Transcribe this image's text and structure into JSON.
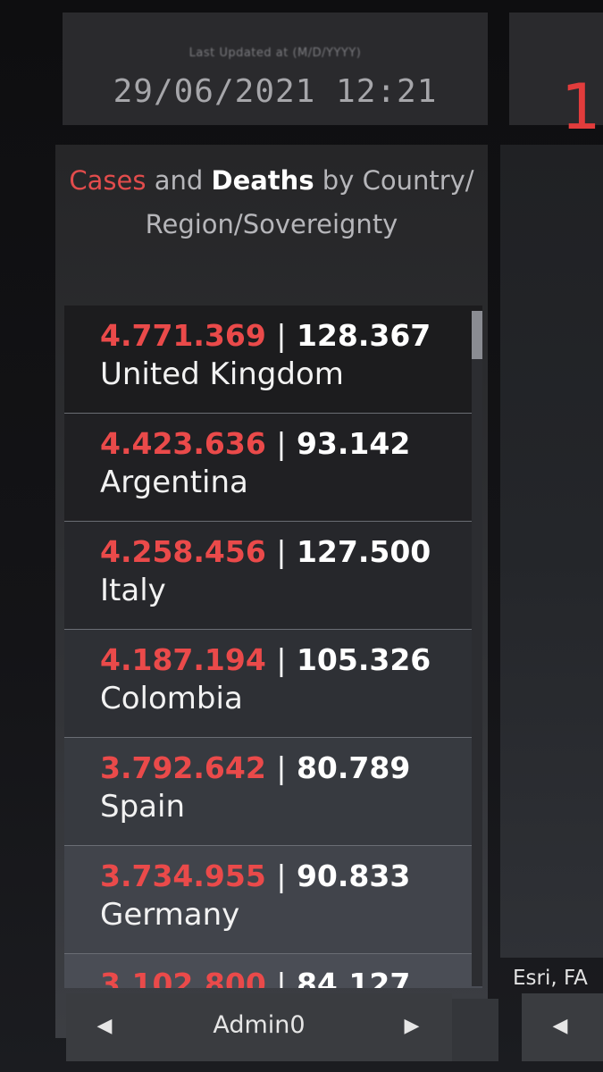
{
  "header": {
    "last_updated_label": "Last Updated at (M/D/YYYY)",
    "last_updated_value": "29/06/2021 12:21"
  },
  "list": {
    "title_cases": "Cases",
    "title_and": " and ",
    "title_deaths": "Deaths",
    "title_rest": " by Country/Region/Sovereignty",
    "separator": "|",
    "items": [
      {
        "cases": "4.771.369",
        "deaths": "128.367",
        "name": "United Kingdom"
      },
      {
        "cases": "4.423.636",
        "deaths": "93.142",
        "name": "Argentina"
      },
      {
        "cases": "4.258.456",
        "deaths": "127.500",
        "name": "Italy"
      },
      {
        "cases": "4.187.194",
        "deaths": "105.326",
        "name": "Colombia"
      },
      {
        "cases": "3.792.642",
        "deaths": "80.789",
        "name": "Spain"
      },
      {
        "cases": "3.734.955",
        "deaths": "90.833",
        "name": "Germany"
      },
      {
        "cases": "3.102.800",
        "deaths": "84.127",
        "name": ""
      }
    ],
    "scroll_position": 0.0
  },
  "pager": {
    "label": "Admin0",
    "prev_icon": "chevron-left-icon",
    "next_icon": "chevron-right-icon"
  },
  "right_panel": {
    "big_number": "1",
    "attribution": "Esri, FA"
  },
  "colors": {
    "cases": "#ea4a4a",
    "deaths": "#ffffff",
    "panel": "#2a2a2d"
  }
}
